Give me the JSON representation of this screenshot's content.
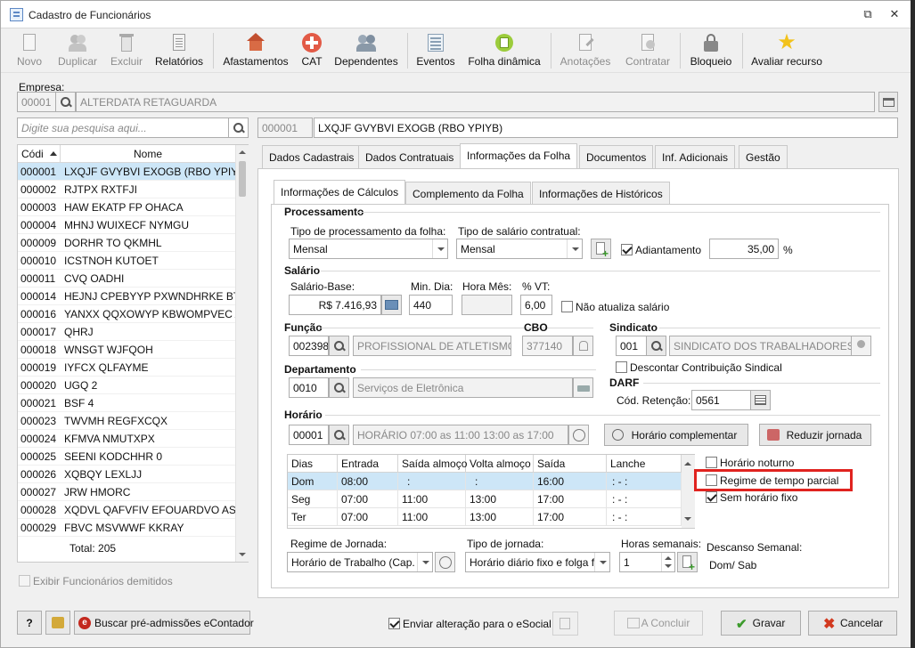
{
  "window": {
    "title": "Cadastro de Funcionários"
  },
  "toolbar": {
    "novo": "Novo",
    "duplicar": "Duplicar",
    "excluir": "Excluir",
    "relatorios": "Relatórios",
    "afastamentos": "Afastamentos",
    "cat": "CAT",
    "dependentes": "Dependentes",
    "eventos": "Eventos",
    "folha_dinamica": "Folha dinâmica",
    "anotacoes": "Anotações",
    "contratar": "Contratar",
    "bloqueio": "Bloqueio",
    "avaliar": "Avaliar recurso"
  },
  "empresa": {
    "label": "Empresa:",
    "code": "00001",
    "name": "ALTERDATA RETAGUARDA"
  },
  "search": {
    "placeholder": "Digite sua pesquisa aqui..."
  },
  "employee_header": {
    "code": "000001",
    "name": "LXQJF GVYBVI EXOGB (RBO YPIYB)"
  },
  "list": {
    "col_code": "Códi",
    "col_name": "Nome",
    "rows": [
      {
        "code": "000001",
        "name": "LXQJF GVYBVI EXOGB (RBO YPIYB)"
      },
      {
        "code": "000002",
        "name": "RJTPX RXTFJI"
      },
      {
        "code": "000003",
        "name": "HAW EKATP FP OHACA"
      },
      {
        "code": "000004",
        "name": "MHNJ WUIXECF NYMGU"
      },
      {
        "code": "000009",
        "name": "DORHR TO QKMHL"
      },
      {
        "code": "000010",
        "name": "ICSTNOH KUTOET"
      },
      {
        "code": "000011",
        "name": "CVQ OADHI"
      },
      {
        "code": "000014",
        "name": "HEJNJ CPEBYYP PXWNDHRKE BTB J"
      },
      {
        "code": "000016",
        "name": "YANXX QQXOWYP KBWOMPVEC A"
      },
      {
        "code": "000017",
        "name": "QHRJ"
      },
      {
        "code": "000018",
        "name": "WNSGT WJFQOH"
      },
      {
        "code": "000019",
        "name": "IYFCX QLFAYME"
      },
      {
        "code": "000020",
        "name": "UGQ 2"
      },
      {
        "code": "000021",
        "name": "BSF 4"
      },
      {
        "code": "000023",
        "name": "TWVMH REGFXCQX"
      },
      {
        "code": "000024",
        "name": "KFMVA NMUTXPX"
      },
      {
        "code": "000025",
        "name": "SEENI KODCHHR 0"
      },
      {
        "code": "000026",
        "name": "XQBQY LEXLJJ"
      },
      {
        "code": "000027",
        "name": "JRW HMORC"
      },
      {
        "code": "000028",
        "name": "XQDVL QAFVFIV EFOUARDVO AST U"
      },
      {
        "code": "000029",
        "name": "FBVC MSVWWF KKRAY"
      }
    ],
    "total": "Total: 205"
  },
  "show_dismissed": "Exibir Funcionários demitidos",
  "tabs": [
    "Dados Cadastrais",
    "Dados Contratuais",
    "Informações da Folha",
    "Documentos",
    "Inf. Adicionais",
    "Gestão"
  ],
  "subtabs": [
    "Informações de Cálculos",
    "Complemento da Folha",
    "Informações de  Históricos"
  ],
  "processamento": {
    "title": "Processamento",
    "tipo_proc_label": "Tipo de processamento da folha:",
    "tipo_proc_value": "Mensal",
    "tipo_sal_label": "Tipo de salário contratual:",
    "tipo_sal_value": "Mensal",
    "adiantamento_label": "Adiantamento",
    "adiantamento_value": "35,00",
    "pct": "%"
  },
  "salario": {
    "title": "Salário",
    "base_label": "Salário-Base:",
    "base_value": "R$ 7.416,93",
    "min_dia_label": "Min. Dia:",
    "min_dia_value": "440",
    "hora_mes_label": "Hora Mês:",
    "vt_label": "% VT:",
    "vt_value": "6,00",
    "nao_atualiza": "Não atualiza salário"
  },
  "funcao": {
    "title": "Função",
    "code": "002398",
    "name": "PROFISSIONAL DE ATLETISMO",
    "cbo_label": "CBO",
    "cbo": "377140"
  },
  "sindicato": {
    "title": "Sindicato",
    "code": "001",
    "name": "SINDICATO DOS TRABALHADORES DE",
    "descontar": "Descontar Contribuição Sindical"
  },
  "departamento": {
    "title": "Departamento",
    "code": "0010",
    "name": "Serviços de Eletrônica"
  },
  "darf": {
    "title": "DARF",
    "label": "Cód. Retenção:",
    "value": "0561"
  },
  "horario": {
    "title": "Horário",
    "code": "00001",
    "name": "HORÁRIO 07:00 as 11:00  13:00 as 17:00",
    "complementar": "Horário complementar",
    "reduzir": "Reduzir jornada",
    "cols": [
      "Dias",
      "Entrada",
      "Saída almoço",
      "Volta almoço",
      "Saída",
      "Lanche"
    ],
    "rows": [
      [
        "Dom",
        "08:00",
        ":",
        ":",
        "16:00",
        ":  -  :"
      ],
      [
        "Seg",
        "07:00",
        "11:00",
        "13:00",
        "17:00",
        ":  -  :"
      ],
      [
        "Ter",
        "07:00",
        "11:00",
        "13:00",
        "17:00",
        ":  -  :"
      ]
    ],
    "noturno": "Horário noturno",
    "parcial": "Regime de tempo parcial",
    "sem_fixo": "Sem horário fixo"
  },
  "regime": {
    "label": "Regime de Jornada:",
    "value": "Horário de Trabalho (Cap."
  },
  "tipo_jornada": {
    "label": "Tipo de jornada:",
    "value": "Horário diário fixo e folga f"
  },
  "horas_semanais": {
    "label": "Horas semanais:",
    "value": "1"
  },
  "descanso": {
    "label": "Descanso Semanal:",
    "value": "Dom/ Sab"
  },
  "footer": {
    "buscar": "Buscar pré-admissões eContador",
    "enviar": "Enviar alteração para o eSocial",
    "concluir": "A Concluir",
    "gravar": "Gravar",
    "cancelar": "Cancelar"
  },
  "colors": {
    "highlight": "#cde6f7",
    "annotation": "#e0231f",
    "tab_active": "#ffffff"
  }
}
